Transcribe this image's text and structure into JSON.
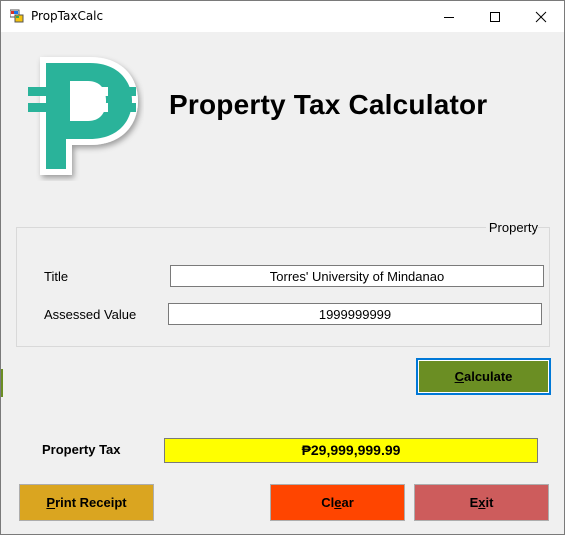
{
  "window": {
    "title": "PropTaxCalc"
  },
  "header": {
    "heading": "Property Tax Calculator",
    "logo_icon": "peso-sign-icon",
    "logo_color": "#2ab39a"
  },
  "property_group": {
    "legend": "Property",
    "title_label": "Title",
    "title_value": "Torres' University of Mindanao",
    "assessed_label": "Assessed Value",
    "assessed_value": "1999999999"
  },
  "calculate_button": {
    "prefix": "",
    "mnemonic": "C",
    "rest": "alculate",
    "color": "#6b8e23"
  },
  "result": {
    "label": "Property Tax",
    "value": "₱29,999,999.99",
    "highlight_color": "#ffff00"
  },
  "buttons": {
    "print": {
      "prefix": "",
      "mnemonic": "P",
      "rest": "rint Receipt",
      "color": "#daa520"
    },
    "clear": {
      "prefix": "Cl",
      "mnemonic": "e",
      "rest": "ar",
      "color": "#ff4500"
    },
    "exit": {
      "prefix": "E",
      "mnemonic": "x",
      "rest": "it",
      "color": "#cd5c5c"
    }
  }
}
